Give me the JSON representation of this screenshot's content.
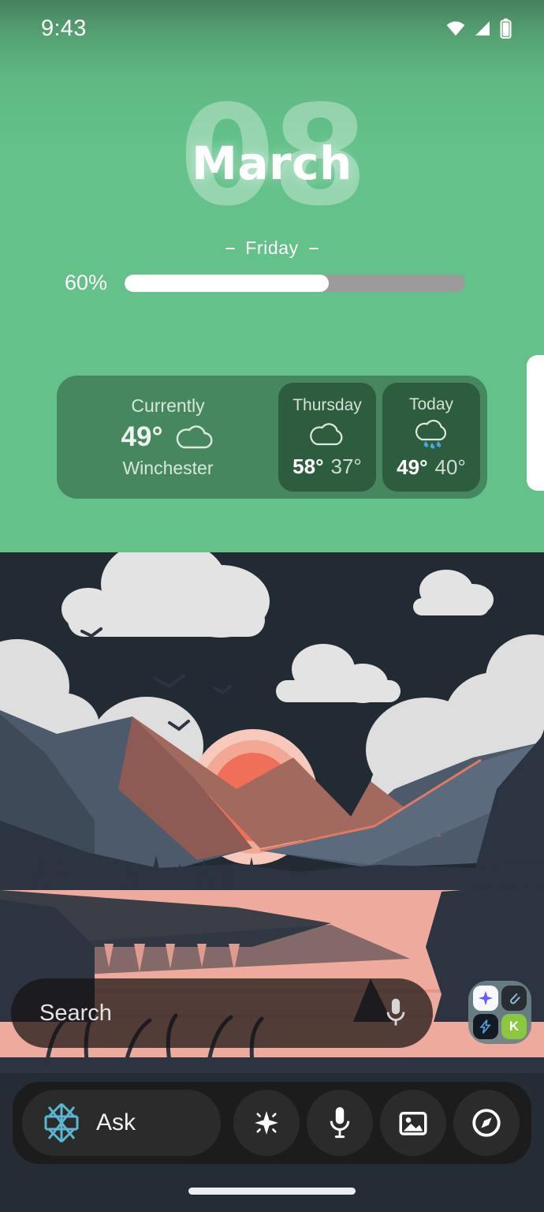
{
  "status_bar": {
    "time": "9:43",
    "icons": [
      "wifi-icon",
      "cellular-signal-icon",
      "battery-icon"
    ]
  },
  "date_widget": {
    "day_number": "08",
    "month": "March",
    "weekday": "Friday",
    "dash_left": "-",
    "dash_right": "-"
  },
  "progress": {
    "label": "60%",
    "percent": 60,
    "fill_color": "#ffffff",
    "track_color": "#9b9b9b"
  },
  "weather": {
    "widget_bg": "#47875f",
    "card_bg": "#2e5c3f",
    "current": {
      "label": "Currently",
      "temperature": "49°",
      "city": "Winchester",
      "icon": "cloud-icon"
    },
    "forecast": [
      {
        "day": "Thursday",
        "icon": "cloud-icon",
        "high": "58°",
        "low": "37°"
      },
      {
        "day": "Today",
        "icon": "rain-cloud-icon",
        "high": "49°",
        "low": "40°"
      }
    ]
  },
  "search": {
    "placeholder": "Search",
    "mic_icon": "microphone-icon"
  },
  "app_folder": {
    "apps": [
      {
        "name": "gemini-app",
        "glyph": "✦",
        "bg": "#f6f8fb"
      },
      {
        "name": "paperclip-app",
        "glyph": "📎",
        "bg": "#272d30"
      },
      {
        "name": "bolt-app",
        "glyph": "⚡",
        "bg": "#131a21"
      },
      {
        "name": "k-app",
        "glyph": "K",
        "bg": "#8bc83f"
      }
    ]
  },
  "assistant_bar": {
    "ask_label": "Ask",
    "logo_icon": "perplexity-starburst-icon",
    "logo_color": "#5bb7d1",
    "actions": [
      {
        "name": "sparkle-icon"
      },
      {
        "name": "microphone-icon"
      },
      {
        "name": "image-icon"
      },
      {
        "name": "compass-icon"
      }
    ]
  },
  "wallpaper": {
    "description": "flat-illustration-sunset-mountains-lake",
    "sky_top": "#46815f",
    "sky_main": "#63c189",
    "cloud_color": "#e3e3e3",
    "sun_color": "#ef6f58",
    "mountain_slate": "#4c5a6b",
    "mountain_rose": "#a2695f",
    "lake_color": "#eeaa9c",
    "forest_dark": "#2b3440"
  }
}
